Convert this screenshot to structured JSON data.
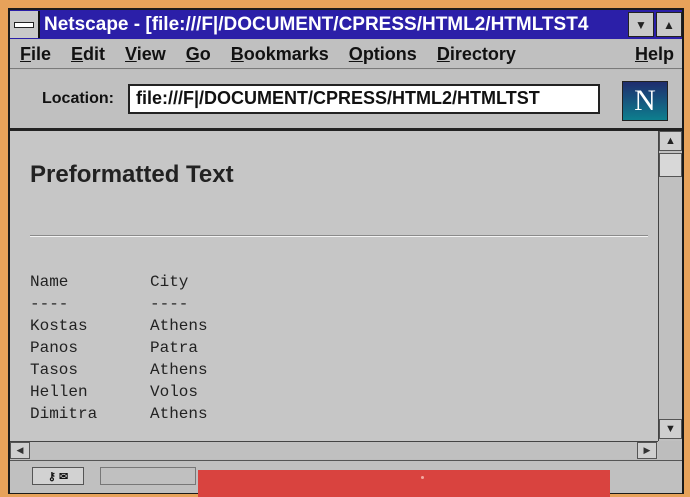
{
  "window": {
    "title": "Netscape - [file:///F|/DOCUMENT/CPRESS/HTML2/HTMLTST4"
  },
  "menu": {
    "items": [
      {
        "key": "F",
        "rest": "ile"
      },
      {
        "key": "E",
        "rest": "dit"
      },
      {
        "key": "V",
        "rest": "iew"
      },
      {
        "key": "G",
        "rest": "o"
      },
      {
        "key": "B",
        "rest": "ookmarks"
      },
      {
        "key": "O",
        "rest": "ptions"
      },
      {
        "key": "D",
        "rest": "irectory"
      },
      {
        "key": "H",
        "rest": "elp"
      }
    ]
  },
  "location": {
    "label": "Location:",
    "value": "file:///F|/DOCUMENT/CPRESS/HTML2/HTMLTST"
  },
  "logo": {
    "letter": "N"
  },
  "page": {
    "heading": "Preformatted Text",
    "table": {
      "header": [
        "Name",
        "City"
      ],
      "separator": [
        "----",
        "----"
      ],
      "rows": [
        [
          "Kostas",
          "Athens"
        ],
        [
          "Panos",
          "Patra"
        ],
        [
          "Tasos",
          "Athens"
        ],
        [
          "Hellen",
          "Volos"
        ],
        [
          "Dimitra",
          "Athens"
        ]
      ]
    }
  },
  "colors": {
    "titlebar": "#2b1fa8",
    "background": "#c6c6c6",
    "frame": "#e7a25a",
    "red_panel": "#d9433f"
  }
}
